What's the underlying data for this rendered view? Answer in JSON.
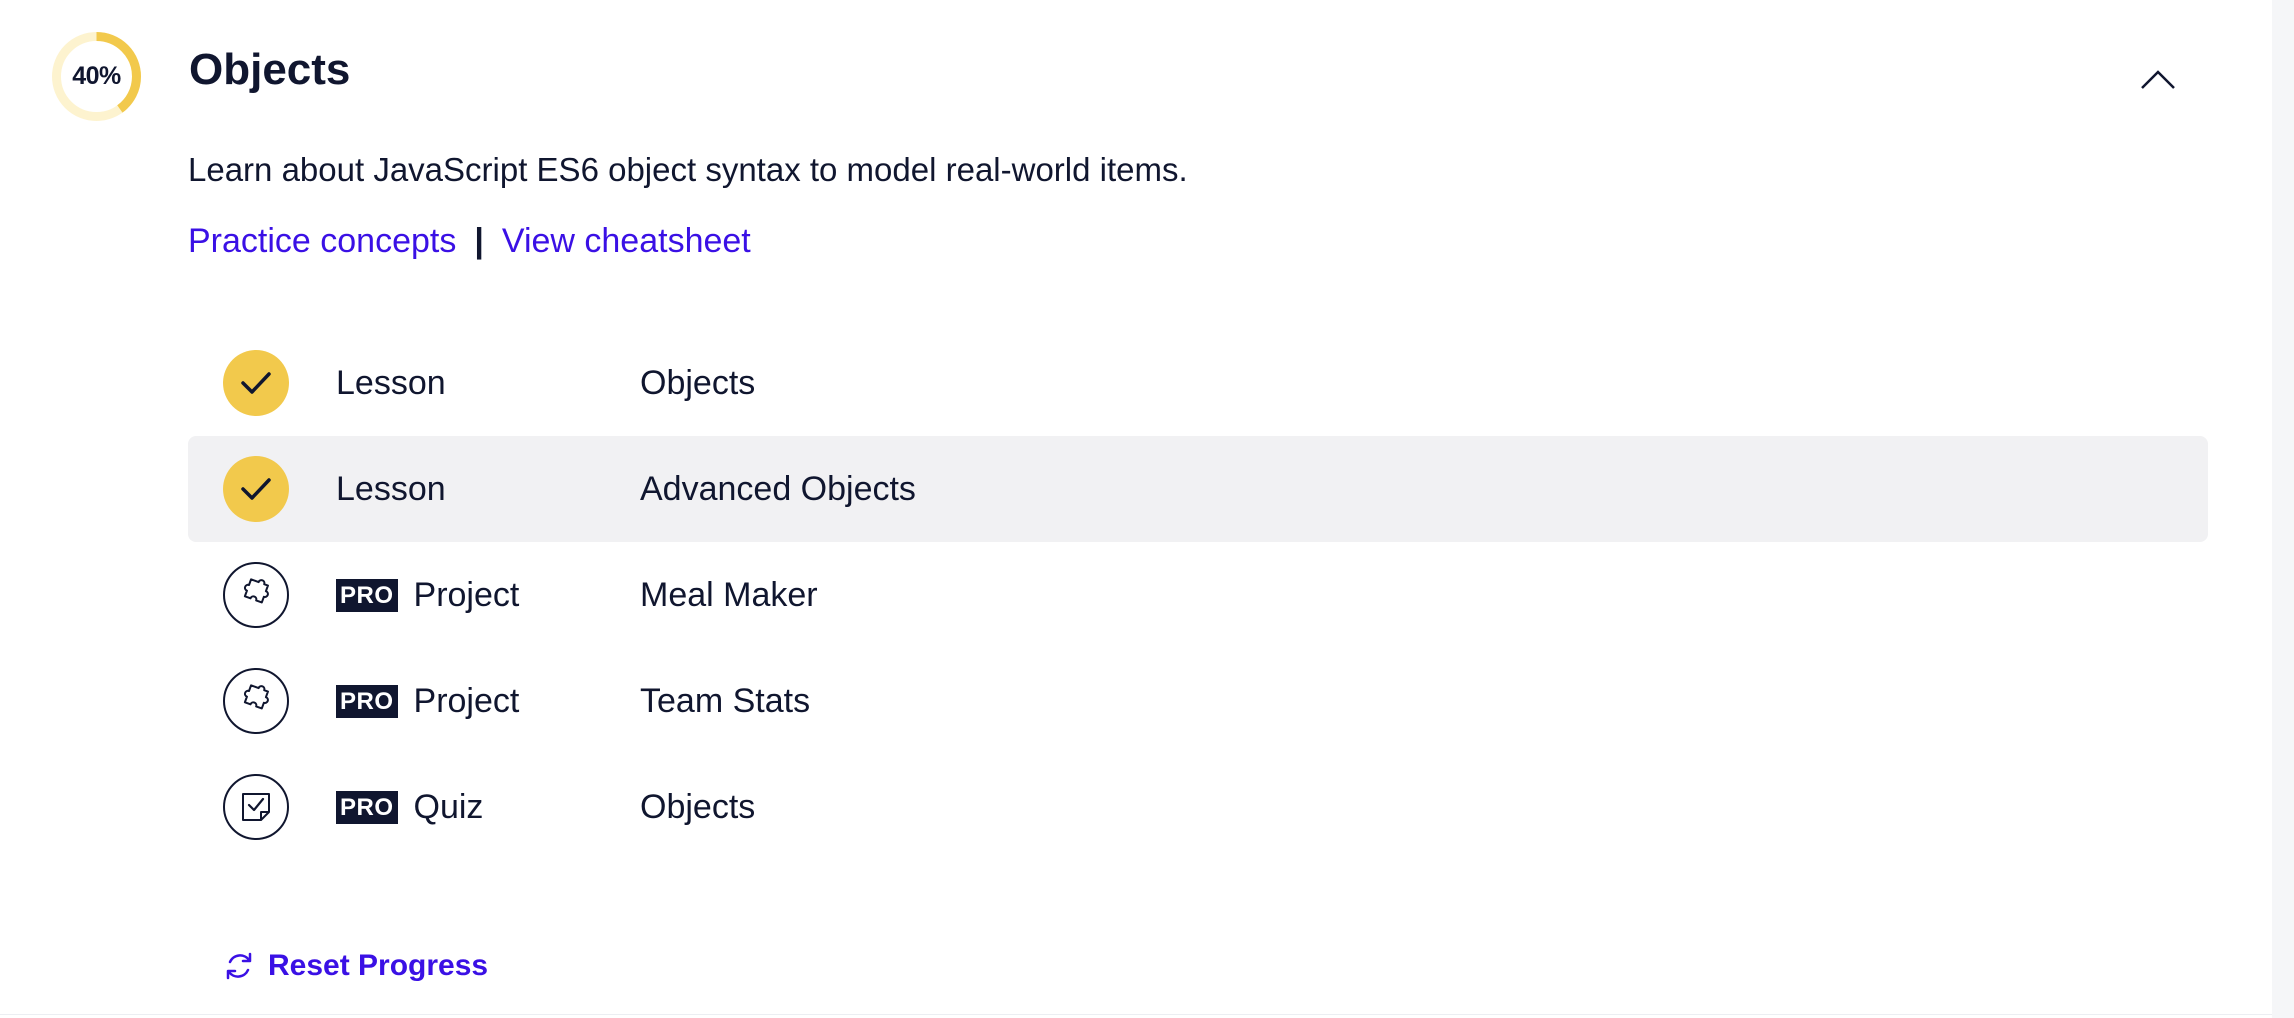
{
  "module": {
    "progress_value": 40,
    "progress_label": "40%",
    "title": "Objects",
    "description": "Learn about JavaScript ES6 object syntax to model real-world items.",
    "collapse_icon": "chevron-up-icon"
  },
  "links": {
    "practice": "Practice concepts",
    "separator": "|",
    "cheatsheet": "View cheatsheet"
  },
  "items": [
    {
      "status": "complete",
      "icon": "check-icon",
      "pro": "",
      "type": "Lesson",
      "name": "Objects"
    },
    {
      "status": "complete",
      "icon": "check-icon",
      "pro": "",
      "type": "Lesson",
      "name": "Advanced Objects"
    },
    {
      "status": "incomplete",
      "icon": "puzzle-icon",
      "pro": "PRO",
      "type": "Project",
      "name": "Meal Maker"
    },
    {
      "status": "incomplete",
      "icon": "puzzle-icon",
      "pro": "PRO",
      "type": "Project",
      "name": "Team Stats"
    },
    {
      "status": "incomplete",
      "icon": "quiz-icon",
      "pro": "PRO",
      "type": "Quiz",
      "name": "Objects"
    }
  ],
  "reset": {
    "label": "Reset Progress",
    "icon": "refresh-icon"
  },
  "colors": {
    "accent": "#3a10e5",
    "complete": "#f2c94c",
    "progress_track": "#fdf3cf",
    "text": "#10162f",
    "active_row": "#f1f1f3"
  }
}
